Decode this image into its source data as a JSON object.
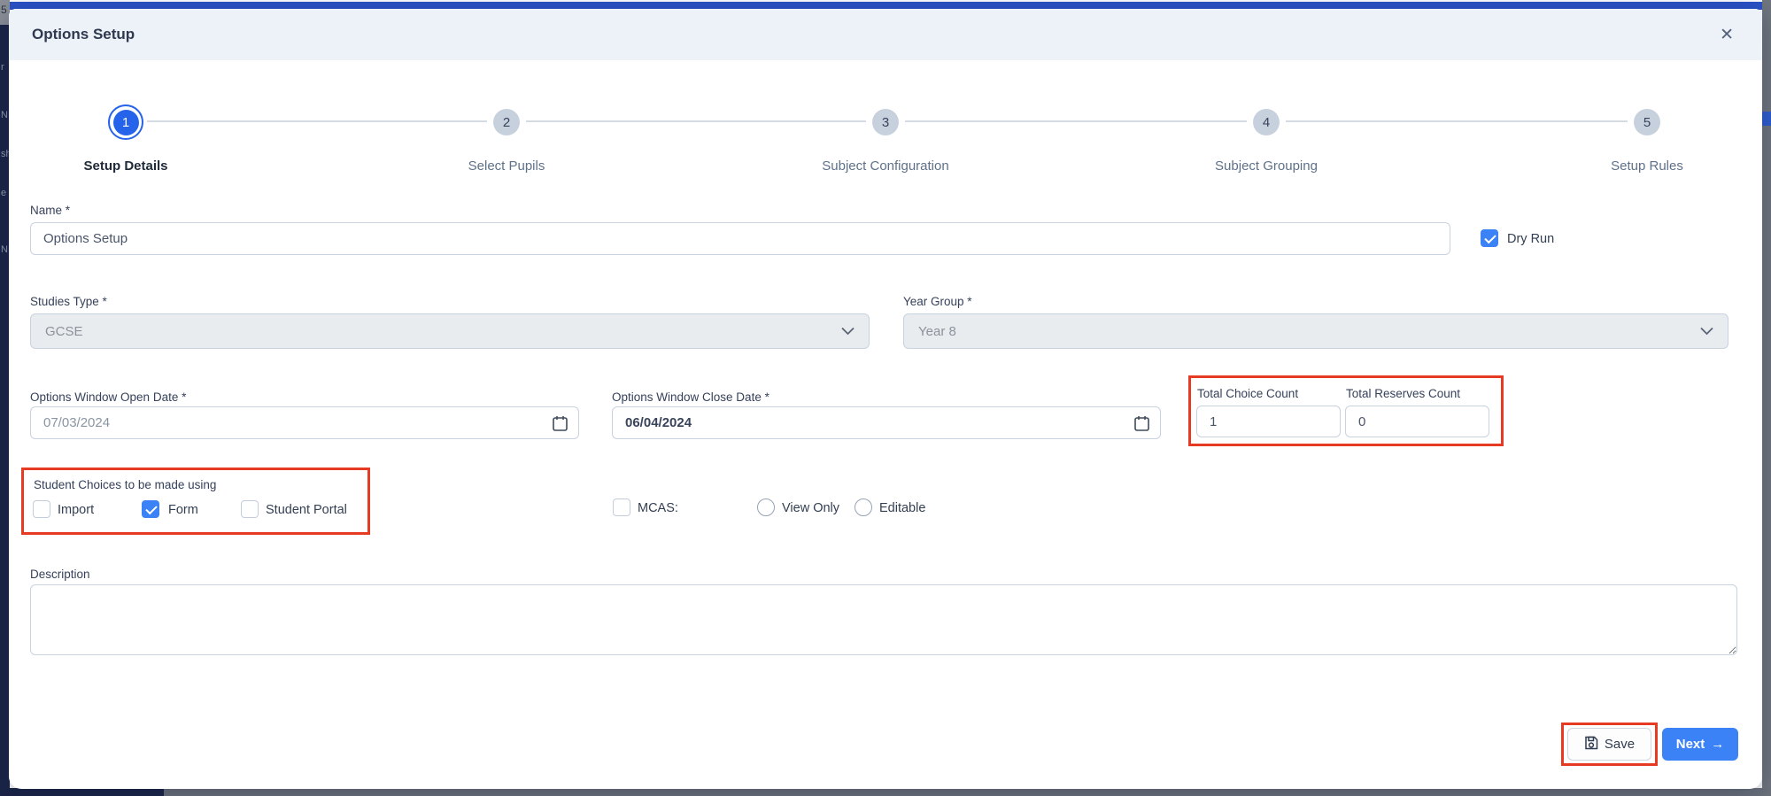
{
  "page_background": {
    "left_fragments": [
      {
        "text": "5"
      },
      {
        "text": "r"
      },
      {
        "text": "N"
      },
      {
        "text": "sh"
      },
      {
        "text": "e"
      },
      {
        "text": "N"
      }
    ]
  },
  "colors": {
    "accent_blue": "#3b82f6",
    "step_blue": "#2563eb",
    "annotation_red": "#e73a23",
    "sidebar_navy": "#1a2447",
    "header_bg": "#edf1f8"
  },
  "modal": {
    "title": "Options Setup",
    "close_icon": "✕",
    "stepper": {
      "steps": [
        {
          "number": "1",
          "label": "Setup Details",
          "active": true
        },
        {
          "number": "2",
          "label": "Select Pupils",
          "active": false
        },
        {
          "number": "3",
          "label": "Subject Configuration",
          "active": false
        },
        {
          "number": "4",
          "label": "Subject Grouping",
          "active": false
        },
        {
          "number": "5",
          "label": "Setup Rules",
          "active": false
        }
      ]
    },
    "form": {
      "name": {
        "label": "Name *",
        "value": "Options Setup"
      },
      "dry_run": {
        "label": "Dry Run",
        "checked": true
      },
      "studies_type": {
        "label": "Studies Type *",
        "value": "GCSE",
        "disabled": true
      },
      "year_group": {
        "label": "Year Group *",
        "value": "Year 8",
        "disabled": true
      },
      "open_date": {
        "label": "Options Window Open Date *",
        "value": "07/03/2024"
      },
      "close_date": {
        "label": "Options Window Close Date *",
        "value": "06/04/2024"
      },
      "total_choice_count": {
        "label": "Total Choice Count",
        "value": "1"
      },
      "total_reserves_count": {
        "label": "Total Reserves Count",
        "value": "0"
      },
      "student_choices": {
        "label": "Student Choices to be made using",
        "options": [
          {
            "label": "Import",
            "checked": false
          },
          {
            "label": "Form",
            "checked": true
          },
          {
            "label": "Student Portal",
            "checked": false
          }
        ]
      },
      "mcas": {
        "label": "MCAS:",
        "checked": false,
        "radios": [
          {
            "label": "View Only",
            "selected": false
          },
          {
            "label": "Editable",
            "selected": false
          }
        ]
      },
      "description": {
        "label": "Description",
        "value": ""
      }
    },
    "footer": {
      "save_label": "Save",
      "next_label": "Next",
      "next_arrow": "→"
    }
  }
}
